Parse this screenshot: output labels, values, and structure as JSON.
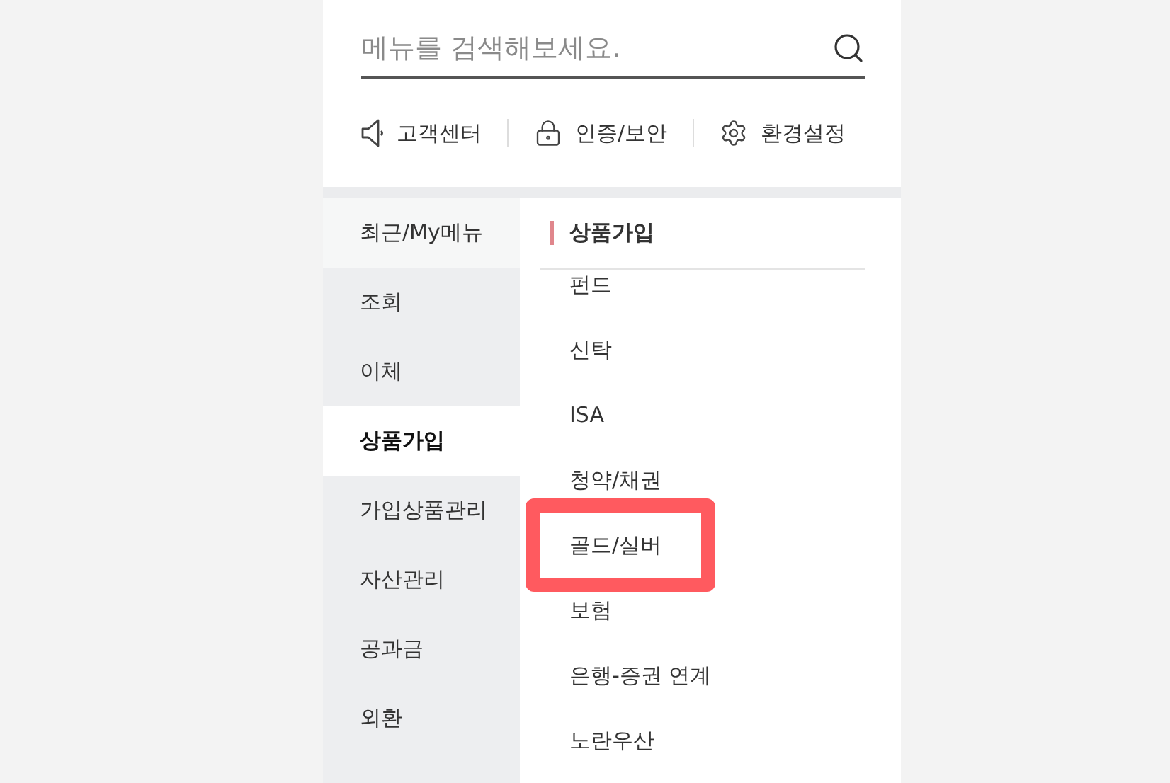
{
  "search": {
    "placeholder": "메뉴를 검색해보세요."
  },
  "quick_links": [
    {
      "kind": "support",
      "label": "고객센터"
    },
    {
      "kind": "security",
      "label": "인증/보안"
    },
    {
      "kind": "settings",
      "label": "환경설정"
    }
  ],
  "categories": [
    {
      "label": "최근/My메뉴",
      "kind": "recent",
      "selected": false
    },
    {
      "label": "조회",
      "kind": "menu",
      "selected": false
    },
    {
      "label": "이체",
      "kind": "menu",
      "selected": false
    },
    {
      "label": "상품가입",
      "kind": "menu",
      "selected": true
    },
    {
      "label": "가입상품관리",
      "kind": "menu",
      "selected": false
    },
    {
      "label": "자산관리",
      "kind": "menu",
      "selected": false
    },
    {
      "label": "공과금",
      "kind": "menu",
      "selected": false
    },
    {
      "label": "외환",
      "kind": "menu",
      "selected": false
    }
  ],
  "section": {
    "title": "상품가입",
    "items": [
      {
        "label": "펀드",
        "highlighted": false
      },
      {
        "label": "신탁",
        "highlighted": false
      },
      {
        "label": "ISA",
        "highlighted": false
      },
      {
        "label": "청약/채권",
        "highlighted": false
      },
      {
        "label": "골드/실버",
        "highlighted": true
      },
      {
        "label": "보험",
        "highlighted": false
      },
      {
        "label": "은행-증권 연계",
        "highlighted": false
      },
      {
        "label": "노란우산",
        "highlighted": false
      }
    ]
  }
}
